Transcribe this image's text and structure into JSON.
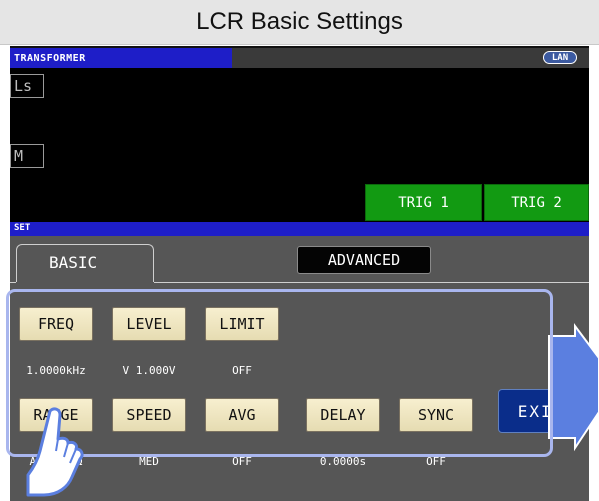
{
  "caption": "LCR Basic Settings",
  "status": {
    "mode_title": "TRANSFORMER",
    "lan_label": "LAN"
  },
  "measurement": {
    "param1": "Ls",
    "param2": "M",
    "trig1_label": "TRIG 1",
    "trig2_label": "TRIG 2"
  },
  "set_section": {
    "title": "SET",
    "tabs": {
      "basic": "BASIC",
      "advanced": "ADVANCED"
    }
  },
  "settings": [
    {
      "label": "FREQ",
      "value": "1.0000kHz"
    },
    {
      "label": "LEVEL",
      "value": "V 1.000V"
    },
    {
      "label": "LIMIT",
      "value": "OFF"
    },
    {
      "label": "RANGE",
      "value": "AUTO 10Ω"
    },
    {
      "label": "SPEED",
      "value": "MED"
    },
    {
      "label": "AVG",
      "value": "OFF"
    },
    {
      "label": "DELAY",
      "value": "0.0000s"
    },
    {
      "label": "SYNC",
      "value": "OFF"
    }
  ],
  "exit_label": "EXIT",
  "colors": {
    "header_blue": "#1e1ec8",
    "trig_green": "#129a12",
    "button_face": "#f0e8c4",
    "panel_gray": "#565656",
    "highlight_frame": "#a9b6ee",
    "arrow_fill": "#5b7fe0"
  },
  "icons": {
    "arrow": "right-arrow-icon",
    "hand": "pointing-hand-icon"
  }
}
